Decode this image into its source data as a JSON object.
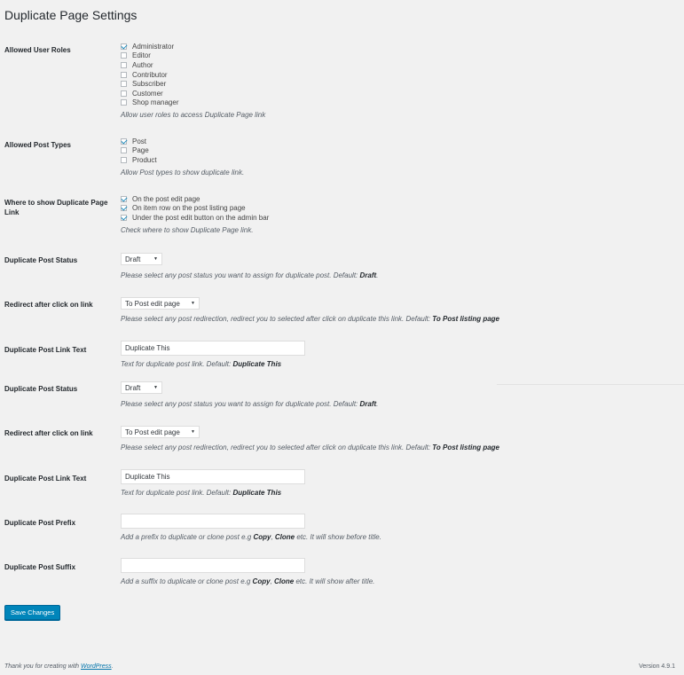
{
  "title": "Duplicate Page Settings",
  "roles": {
    "label": "Allowed User Roles",
    "options": [
      {
        "label": "Administrator",
        "checked": true
      },
      {
        "label": "Editor",
        "checked": false
      },
      {
        "label": "Author",
        "checked": false
      },
      {
        "label": "Contributor",
        "checked": false
      },
      {
        "label": "Subscriber",
        "checked": false
      },
      {
        "label": "Customer",
        "checked": false
      },
      {
        "label": "Shop manager",
        "checked": false
      }
    ],
    "desc": "Allow user roles to access Duplicate Page link"
  },
  "post_types": {
    "label": "Allowed Post Types",
    "options": [
      {
        "label": "Post",
        "checked": true
      },
      {
        "label": "Page",
        "checked": false
      },
      {
        "label": "Product",
        "checked": false
      }
    ],
    "desc": "Allow Post types to show duplicate link."
  },
  "where_show": {
    "label": "Where to show Duplicate Page Link",
    "options": [
      {
        "label": "On the post edit page",
        "checked": true
      },
      {
        "label": "On item row on the post listing page",
        "checked": true
      },
      {
        "label": "Under the post edit button on the admin bar",
        "checked": true
      }
    ],
    "desc": "Check where to show Duplicate Page link."
  },
  "status1": {
    "label": "Duplicate Post Status",
    "value": "Draft",
    "desc_pre": "Please select any post status you want to assign for duplicate post. Default: ",
    "desc_bold": "Draft",
    "desc_post": "."
  },
  "redirect1": {
    "label": "Redirect after click on link",
    "value": "To Post edit page",
    "desc_pre": "Please select any post redirection, redirect you to selected after click on duplicate this link. Default: ",
    "desc_bold": "To Post listing page"
  },
  "linktext1": {
    "label": "Duplicate Post Link Text",
    "value": "Duplicate This",
    "desc_pre": "Text for duplicate post link. Default: ",
    "desc_bold": "Duplicate This"
  },
  "status2": {
    "label": "Duplicate Post Status",
    "value": "Draft",
    "desc_pre": "Please select any post status you want to assign for duplicate post. Default: ",
    "desc_bold": "Draft",
    "desc_post": "."
  },
  "redirect2": {
    "label": "Redirect after click on link",
    "value": "To Post edit page",
    "desc_pre": "Please select any post redirection, redirect you to selected after click on duplicate this link. Default: ",
    "desc_bold": "To Post listing page"
  },
  "linktext2": {
    "label": "Duplicate Post Link Text",
    "value": "Duplicate This",
    "desc_pre": "Text for duplicate post link. Default: ",
    "desc_bold": "Duplicate This"
  },
  "prefix": {
    "label": "Duplicate Post Prefix",
    "value": "",
    "desc_pre": "Add a prefix to duplicate or clone post e.g ",
    "desc_b1": "Copy",
    "desc_mid": ", ",
    "desc_b2": "Clone",
    "desc_post": " etc. It will show before title."
  },
  "suffix": {
    "label": "Duplicate Post Suffix",
    "value": "",
    "desc_pre": "Add a suffix to duplicate or clone post e.g ",
    "desc_b1": "Copy",
    "desc_mid": ", ",
    "desc_b2": "Clone",
    "desc_post": " etc. It will show after title."
  },
  "save_label": "Save Changes",
  "footer": {
    "thanks_pre": "Thank you for creating with ",
    "link": "WordPress",
    "thanks_post": ".",
    "version": "Version 4.9.1"
  }
}
